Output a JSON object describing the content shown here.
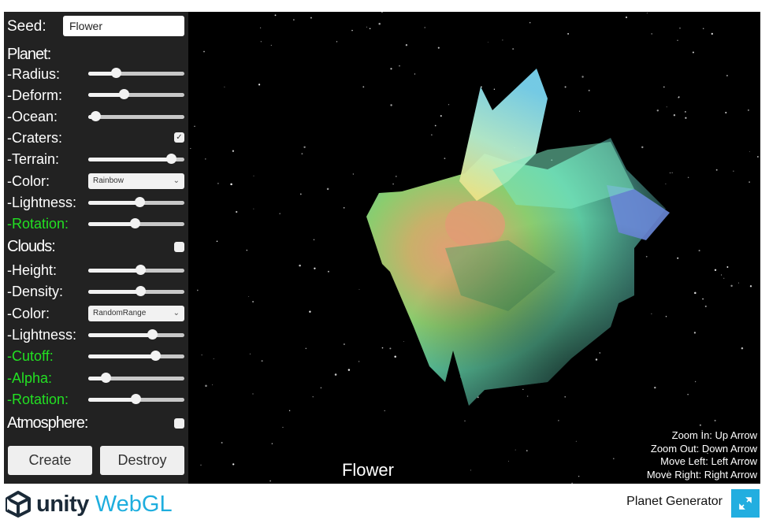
{
  "panel": {
    "seed_label": "Seed:",
    "seed_value": "Flower",
    "planet_header": "Planet:",
    "planet": {
      "radius": {
        "label": "-Radius:",
        "value": 0.29
      },
      "deform": {
        "label": "-Deform:",
        "value": 0.37
      },
      "ocean": {
        "label": "-Ocean:",
        "value": 0.07
      },
      "craters": {
        "label": "-Craters:",
        "checked": true
      },
      "terrain": {
        "label": "-Terrain:",
        "value": 0.86
      },
      "color": {
        "label": "-Color:",
        "selected": "Rainbow"
      },
      "lightness": {
        "label": "-Lightness:",
        "value": 0.53
      },
      "rotation": {
        "label": "-Rotation:",
        "value": 0.48
      }
    },
    "clouds_header": "Clouds:",
    "clouds_checked": false,
    "clouds": {
      "height": {
        "label": "-Height:",
        "value": 0.54
      },
      "density": {
        "label": "-Density:",
        "value": 0.54
      },
      "color": {
        "label": "-Color:",
        "selected": "RandomRange"
      },
      "lightness": {
        "label": "-Lightness:",
        "value": 0.66
      },
      "cutoff": {
        "label": "-Cutoff:",
        "value": 0.7
      },
      "alpha": {
        "label": "-Alpha:",
        "value": 0.18
      },
      "rotation": {
        "label": "-Rotation:",
        "value": 0.49
      }
    },
    "atmosphere_header": "Atmosphere:",
    "atmosphere_checked": false,
    "create_label": "Create",
    "destroy_label": "Destroy"
  },
  "scene": {
    "planet_name": "Flower",
    "help": [
      "Zoom In: Up Arrow",
      "Zoom Out: Down Arrow",
      "Move Left: Left Arrow",
      "Move Right: Right Arrow"
    ]
  },
  "footer": {
    "logo_unity": "unity",
    "logo_webgl": "WebGL",
    "title": "Planet Generator",
    "fullscreen_icon": "fullscreen-icon"
  },
  "colors": {
    "panel_bg": "#222222",
    "green_label": "#22e022",
    "webgl_blue": "#1eaede",
    "fullscreen_bg": "#22aee0"
  }
}
